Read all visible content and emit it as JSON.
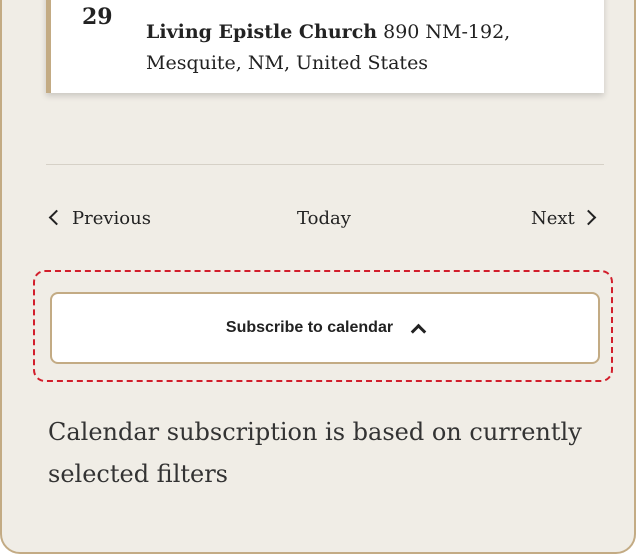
{
  "event": {
    "day": "29",
    "venue_name": "Living Epistle Church",
    "address": " 890 NM-192, Mesquite, NM, United States"
  },
  "navigation": {
    "previous_label": "Previous",
    "today_label": "Today",
    "next_label": "Next"
  },
  "subscribe": {
    "button_label": "Subscribe to calendar",
    "note": "Calendar subscription is based on currently selected filters"
  },
  "colors": {
    "accent": "#c3ab84",
    "highlight": "#d21e2b",
    "background": "#f0ede6"
  },
  "icons": {
    "previous": "chevron-left-icon",
    "next": "chevron-right-icon",
    "subscribe": "chevron-up-icon"
  }
}
